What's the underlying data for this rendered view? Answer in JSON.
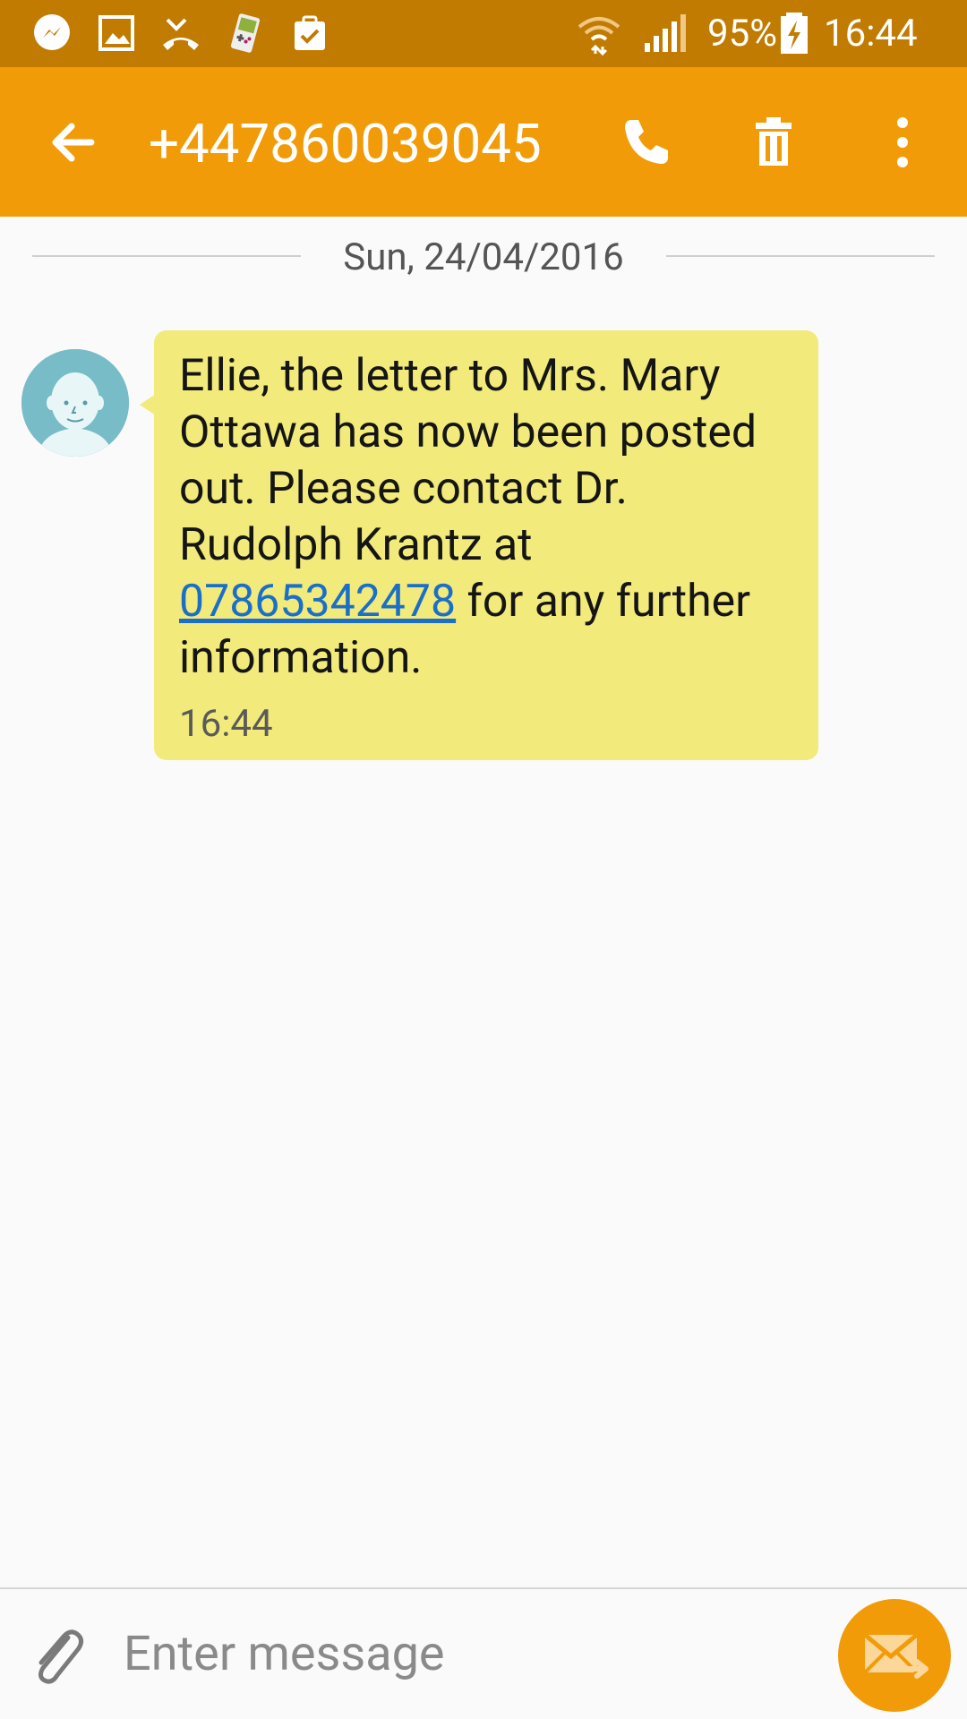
{
  "status_bar": {
    "notification_icons": [
      "messenger-icon",
      "gallery-icon",
      "missed-call-icon",
      "game-boy-icon",
      "clipboard-check-icon"
    ],
    "battery_percent": "95%",
    "time": "16:44"
  },
  "app_bar": {
    "title": "+447860039045",
    "actions": [
      "back-arrow-icon",
      "phone-icon",
      "trash-icon",
      "more-vert-icon"
    ]
  },
  "conversation": {
    "date_label": "Sun, 24/04/2016",
    "messages": [
      {
        "text_before_link": "Ellie, the letter to Mrs. Mary Ottawa has now been posted out. Please contact Dr. Rudolph Krantz at ",
        "link": "07865342478",
        "text_after_link": " for any further information.",
        "time": "16:44"
      }
    ]
  },
  "compose": {
    "placeholder": "Enter message"
  },
  "colors": {
    "status_bar": "#c17b00",
    "app_bar": "#f29b08",
    "bubble": "#f2ea7a",
    "link": "#1a6fc8",
    "send_button": "#f29b08"
  }
}
